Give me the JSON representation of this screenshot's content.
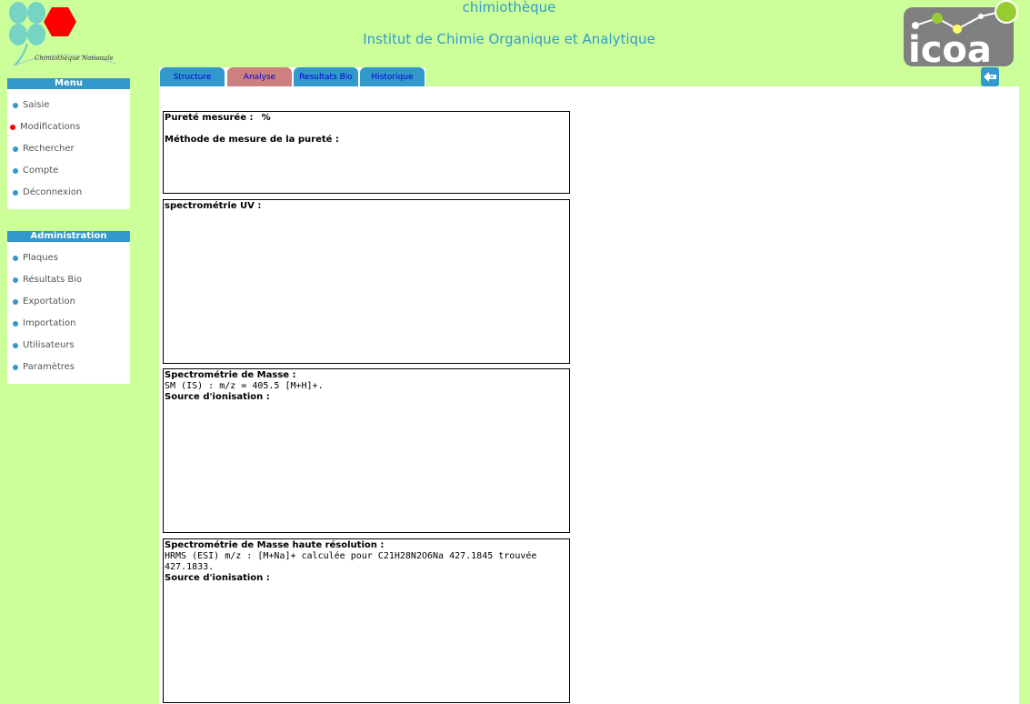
{
  "header": {
    "app_title": "chimiothèque",
    "institute_title": "Institut de Chimie Organique et Analytique",
    "logo_left_caption": "Chimiothèque Nationale",
    "logo_right_text": "icoa"
  },
  "sidebar": {
    "menu": {
      "title": "Menu",
      "items": [
        {
          "label": "Saisie",
          "active": false
        },
        {
          "label": "Modifications",
          "active": true
        },
        {
          "label": "Rechercher",
          "active": false
        },
        {
          "label": "Compte",
          "active": false
        },
        {
          "label": "Déconnexion",
          "active": false
        }
      ]
    },
    "administration": {
      "title": "Administration",
      "items": [
        {
          "label": "Plaques"
        },
        {
          "label": "Résultats Bio"
        },
        {
          "label": "Exportation"
        },
        {
          "label": "Importation"
        },
        {
          "label": "Utilisateurs"
        },
        {
          "label": "Paramètres"
        }
      ]
    }
  },
  "tabs": [
    {
      "label": "Structure",
      "active": false
    },
    {
      "label": "Analyse",
      "active": true
    },
    {
      "label": "Resultats Bio",
      "active": false
    },
    {
      "label": "Historique",
      "active": false
    }
  ],
  "analysis": {
    "purity": {
      "label": "Pureté mesurée :",
      "unit": "%",
      "method_label": "Méthode de mesure de la pureté :"
    },
    "uv": {
      "label": "spectrométrie UV :"
    },
    "mass": {
      "label": "Spectrométrie de Masse :",
      "value": "SM (IS) : m/z = 405.5 [M+H]+.",
      "source_label": "Source d'ionisation :"
    },
    "hrms": {
      "label": "Spectrométrie de Masse haute résolution :",
      "value_line1": "HRMS (ESI) m/z : [M+Na]+ calculée pour C21H28N2O6Na 427.1845 trouvée",
      "value_line2": "427.1833.",
      "source_label": "Source d'ionisation :"
    }
  },
  "colors": {
    "page_bg": "#ccff99",
    "accent_blue": "#3399cc",
    "active_tab": "#cc8080",
    "active_bullet": "#ff0000"
  }
}
